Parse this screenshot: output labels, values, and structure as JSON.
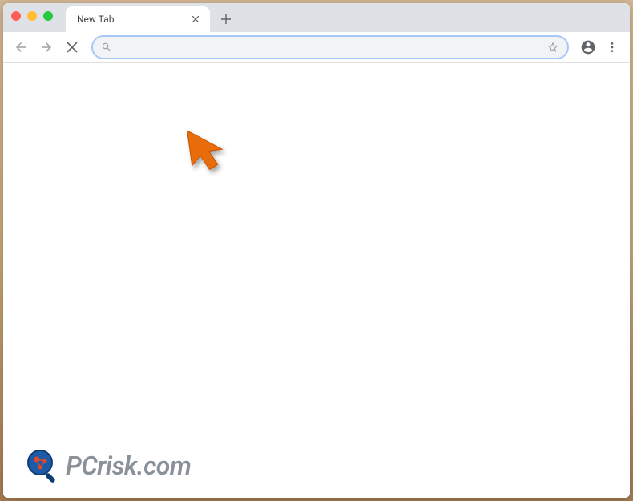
{
  "window": {
    "os": "mac"
  },
  "tab": {
    "title": "New Tab"
  },
  "omnibox": {
    "value": "",
    "placeholder": ""
  },
  "watermark": {
    "text": "PCrisk.com"
  },
  "colors": {
    "cursor_orange": "#e86c0a",
    "tab_strip_bg": "#dee1e6",
    "omnibox_border": "#a8c7fa"
  }
}
